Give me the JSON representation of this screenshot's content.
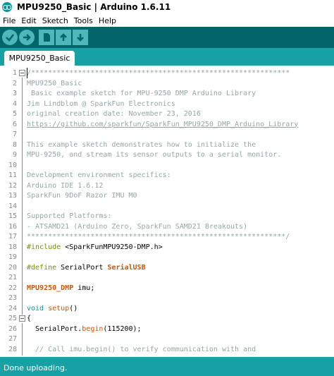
{
  "window": {
    "title": "MPU9250_Basic | Arduino 1.6.11"
  },
  "menu": [
    "File",
    "Edit",
    "Sketch",
    "Tools",
    "Help"
  ],
  "toolbar": {
    "buttons": [
      {
        "name": "verify",
        "icon": "check-icon"
      },
      {
        "name": "upload",
        "icon": "arrow-right-icon"
      },
      {
        "name": "new",
        "icon": "new-file-icon"
      },
      {
        "name": "open",
        "icon": "arrow-up-icon"
      },
      {
        "name": "save",
        "icon": "arrow-down-icon"
      }
    ]
  },
  "tabs": [
    {
      "label": "MPU9250_Basic",
      "active": true
    }
  ],
  "editor": {
    "lines": [
      {
        "n": "1",
        "fold": true,
        "cursor": true,
        "parts": [
          {
            "t": "/*************************************************************",
            "c": "comment"
          }
        ]
      },
      {
        "n": "2",
        "parts": [
          {
            "t": "MPU9250_Basic",
            "c": "comment"
          }
        ]
      },
      {
        "n": "3",
        "parts": [
          {
            "t": " Basic example sketch for MPU-9250 DMP Arduino Library",
            "c": "comment"
          }
        ]
      },
      {
        "n": "4",
        "parts": [
          {
            "t": "Jim Lindblom @ SparkFun Electronics",
            "c": "comment"
          }
        ]
      },
      {
        "n": "5",
        "parts": [
          {
            "t": "original creation date: November 23, 2016",
            "c": "comment"
          }
        ]
      },
      {
        "n": "6",
        "parts": [
          {
            "t": "https://github.com/sparkfun/SparkFun_MPU9250_DMP_Arduino_Library",
            "c": "link"
          }
        ]
      },
      {
        "n": "7",
        "parts": []
      },
      {
        "n": "8",
        "parts": [
          {
            "t": "This example sketch demonstrates how to initialize the",
            "c": "comment"
          }
        ]
      },
      {
        "n": "9",
        "parts": [
          {
            "t": "MPU-9250, and stream its sensor outputs to a serial monitor.",
            "c": "comment"
          }
        ]
      },
      {
        "n": "10",
        "parts": []
      },
      {
        "n": "11",
        "parts": [
          {
            "t": "Development environment specifics:",
            "c": "comment"
          }
        ]
      },
      {
        "n": "12",
        "parts": [
          {
            "t": "Arduino IDE 1.6.12",
            "c": "comment"
          }
        ]
      },
      {
        "n": "13",
        "parts": [
          {
            "t": "SparkFun 9DoF Razor IMU M0",
            "c": "comment"
          }
        ]
      },
      {
        "n": "14",
        "parts": []
      },
      {
        "n": "15",
        "parts": [
          {
            "t": "Supported Platforms:",
            "c": "comment"
          }
        ]
      },
      {
        "n": "16",
        "parts": [
          {
            "t": "- ATSAMD21 (Arduino Zero, SparkFun SAMD21 Breakouts)",
            "c": "comment"
          }
        ]
      },
      {
        "n": "17",
        "parts": [
          {
            "t": "*************************************************************/",
            "c": "comment"
          }
        ]
      },
      {
        "n": "18",
        "parts": [
          {
            "t": "#include",
            "c": "kw"
          },
          {
            "t": " <SparkFunMPU9250-DMP.h>",
            "c": ""
          }
        ]
      },
      {
        "n": "19",
        "parts": []
      },
      {
        "n": "20",
        "parts": [
          {
            "t": "#define",
            "c": "kw"
          },
          {
            "t": " SerialPort ",
            "c": ""
          },
          {
            "t": "SerialUSB",
            "c": "cls"
          }
        ]
      },
      {
        "n": "21",
        "parts": []
      },
      {
        "n": "22",
        "parts": [
          {
            "t": "MPU9250_DMP",
            "c": "cls"
          },
          {
            "t": " imu;",
            "c": ""
          }
        ]
      },
      {
        "n": "23",
        "parts": []
      },
      {
        "n": "24",
        "parts": [
          {
            "t": "void",
            "c": "type"
          },
          {
            "t": " ",
            "c": ""
          },
          {
            "t": "setup",
            "c": "kw2"
          },
          {
            "t": "()",
            "c": ""
          }
        ]
      },
      {
        "n": "25",
        "fold": true,
        "parts": [
          {
            "t": "{",
            "c": ""
          }
        ]
      },
      {
        "n": "26",
        "parts": [
          {
            "t": "  SerialPort.",
            "c": ""
          },
          {
            "t": "begin",
            "c": "kw2"
          },
          {
            "t": "(115200);",
            "c": ""
          }
        ]
      },
      {
        "n": "27",
        "parts": []
      },
      {
        "n": "28",
        "parts": [
          {
            "t": "  // Call imu.begin() to verify communication with and",
            "c": "comment"
          }
        ]
      }
    ]
  },
  "status": {
    "message": "Done uploading."
  },
  "colors": {
    "toolbar": "#006468",
    "accent": "#17a1a5",
    "button": "#4db7bb",
    "comment": "#95a5a6",
    "keyword": "#728e00",
    "function": "#d35400",
    "type": "#00979c"
  }
}
